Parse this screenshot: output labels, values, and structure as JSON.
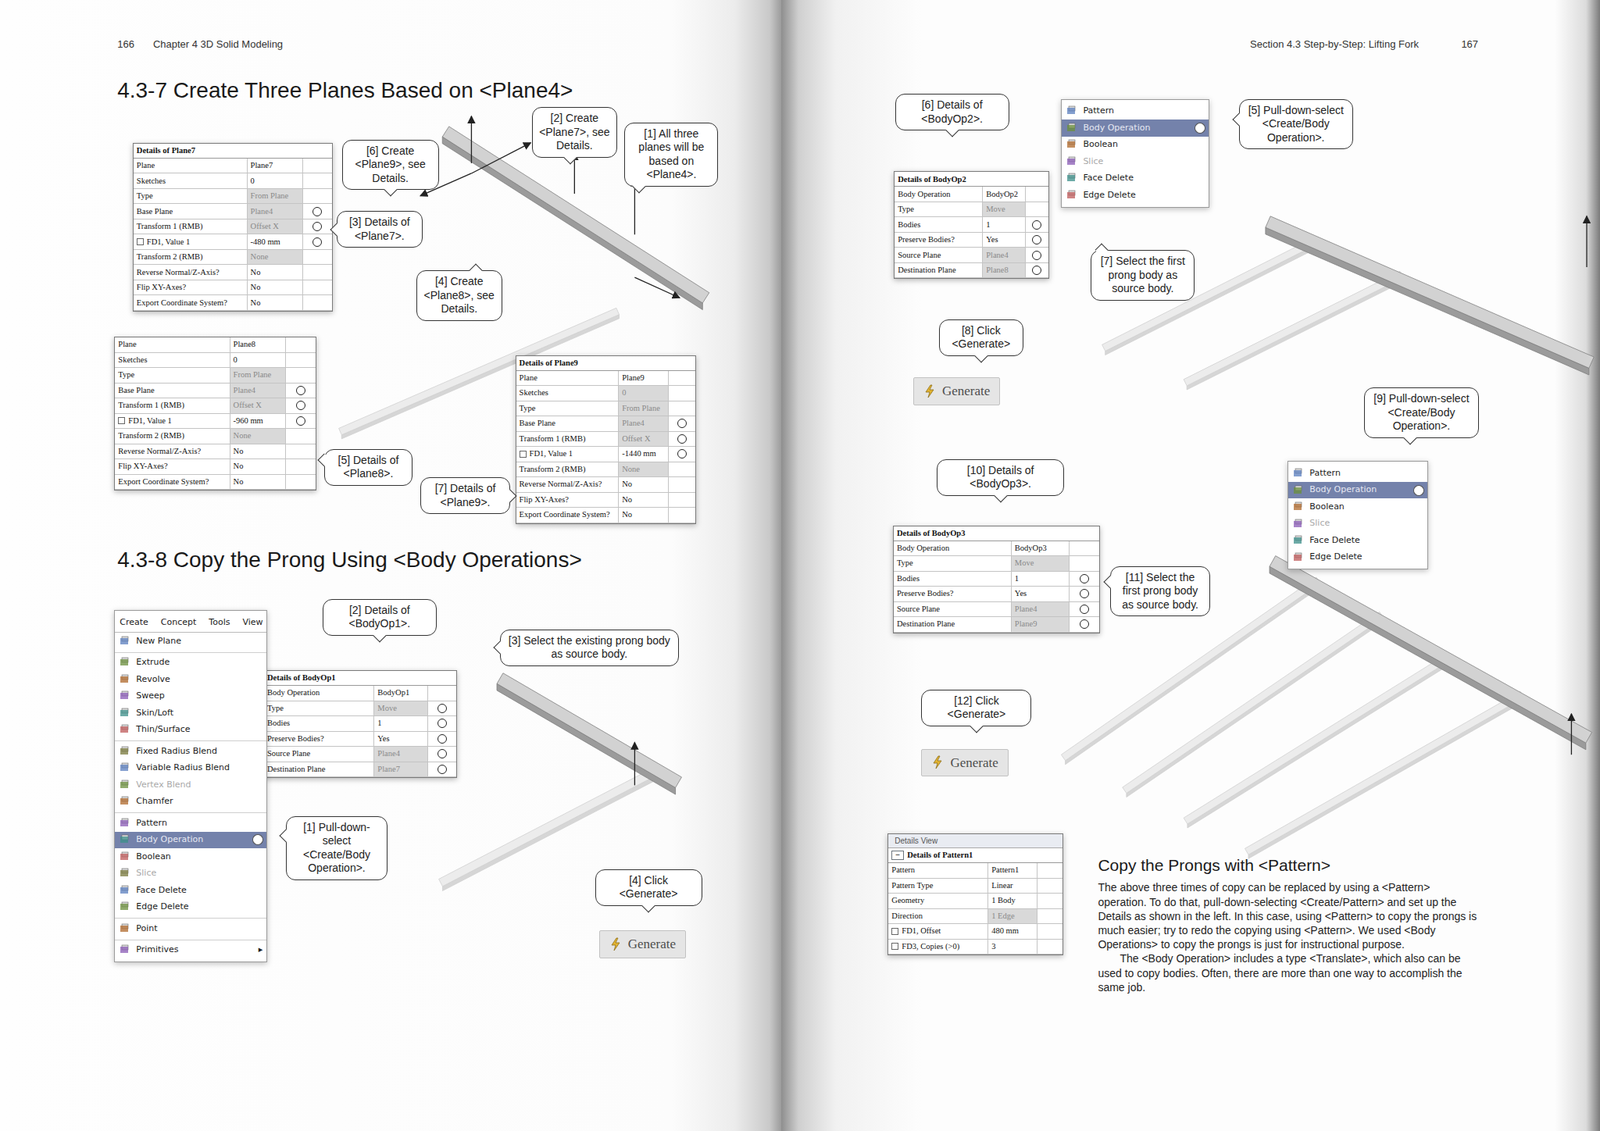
{
  "left_page": {
    "page_number": "166",
    "running_head": "Chapter 4  3D Solid Modeling",
    "heading_planes": "4.3-7  Create Three Planes Based on <Plane4>",
    "heading_copy": "4.3-8  Copy the Prong Using <Body Operations>"
  },
  "right_page": {
    "page_number": "167",
    "running_head": "Section 4.3  Step-by-Step: Lifting Fork"
  },
  "callouts": [
    {
      "text": "[1] All three planes will be based on <Plane4>."
    },
    {
      "text": "[2] Create <Plane7>, see Details."
    },
    {
      "text": "[3] Details of <Plane7>."
    },
    {
      "text": "[4] Create <Plane8>, see Details."
    },
    {
      "text": "[5] Details of <Plane8>."
    },
    {
      "text": "[6] Create <Plane9>, see Details."
    },
    {
      "text": "[7] Details of <Plane9>."
    },
    {
      "text": "[1] Pull-down-select <Create/Body Operation>."
    },
    {
      "text": "[2] Details of <BodyOp1>."
    },
    {
      "text": "[3] Select the existing prong body as source body."
    },
    {
      "text": "[4] Click <Generate>"
    },
    {
      "text": "[5] Pull-down-select <Create/Body Operation>."
    },
    {
      "text": "[6] Details of <BodyOp2>."
    },
    {
      "text": "[7] Select the first prong body as source body."
    },
    {
      "text": "[8] Click <Generate>"
    },
    {
      "text": "[9] Pull-down-select <Create/Body Operation>."
    },
    {
      "text": "[10] Details of <BodyOp3>."
    },
    {
      "text": "[11] Select the first prong body as source body."
    },
    {
      "text": "[12] Click <Generate>"
    }
  ],
  "tables": [
    {
      "title": "Details of Plane7",
      "rows": [
        {
          "label": "Plane",
          "value": "Plane7",
          "greyed": false,
          "marked": false,
          "kind": "plain"
        },
        {
          "label": "Sketches",
          "value": "0",
          "greyed": false,
          "marked": false,
          "kind": "plain"
        },
        {
          "label": "Type",
          "value": "From Plane",
          "greyed": true,
          "marked": false,
          "kind": "plain"
        },
        {
          "label": "Base Plane",
          "value": "Plane4",
          "greyed": true,
          "marked": true,
          "kind": "plain"
        },
        {
          "label": "Transform 1 (RMB)",
          "value": "Offset X",
          "greyed": true,
          "marked": true,
          "kind": "plain"
        },
        {
          "label": "FD1, Value 1",
          "value": "-480 mm",
          "greyed": false,
          "marked": true,
          "kind": "param"
        },
        {
          "label": "Transform 2 (RMB)",
          "value": "None",
          "greyed": true,
          "marked": false,
          "kind": "plain"
        },
        {
          "label": "Reverse Normal/Z-Axis?",
          "value": "No",
          "greyed": false,
          "marked": false,
          "kind": "plain"
        },
        {
          "label": "Flip XY-Axes?",
          "value": "No",
          "greyed": false,
          "marked": false,
          "kind": "plain"
        },
        {
          "label": "Export Coordinate System?",
          "value": "No",
          "greyed": false,
          "marked": false,
          "kind": "plain"
        }
      ]
    },
    {
      "rows": [
        {
          "label": "Plane",
          "value": "Plane8",
          "greyed": false,
          "marked": false,
          "kind": "plain"
        },
        {
          "label": "Sketches",
          "value": "0",
          "greyed": false,
          "marked": false,
          "kind": "plain"
        },
        {
          "label": "Type",
          "value": "From Plane",
          "greyed": true,
          "marked": false,
          "kind": "plain"
        },
        {
          "label": "Base Plane",
          "value": "Plane4",
          "greyed": true,
          "marked": true,
          "kind": "plain"
        },
        {
          "label": "Transform 1 (RMB)",
          "value": "Offset X",
          "greyed": true,
          "marked": true,
          "kind": "plain"
        },
        {
          "label": "FD1, Value 1",
          "value": "-960 mm",
          "greyed": false,
          "marked": true,
          "kind": "param"
        },
        {
          "label": "Transform 2 (RMB)",
          "value": "None",
          "greyed": true,
          "marked": false,
          "kind": "plain"
        },
        {
          "label": "Reverse Normal/Z-Axis?",
          "value": "No",
          "greyed": false,
          "marked": false,
          "kind": "plain"
        },
        {
          "label": "Flip XY-Axes?",
          "value": "No",
          "greyed": false,
          "marked": false,
          "kind": "plain"
        },
        {
          "label": "Export Coordinate System?",
          "value": "No",
          "greyed": false,
          "marked": false,
          "kind": "plain"
        }
      ]
    },
    {
      "title": "Details of Plane9",
      "rows": [
        {
          "label": "Plane",
          "value": "Plane9",
          "greyed": false,
          "marked": false,
          "kind": "plain"
        },
        {
          "label": "Sketches",
          "value": "0",
          "greyed": true,
          "marked": false,
          "kind": "plain"
        },
        {
          "label": "Type",
          "value": "From Plane",
          "greyed": true,
          "marked": false,
          "kind": "plain"
        },
        {
          "label": "Base Plane",
          "value": "Plane4",
          "greyed": true,
          "marked": true,
          "kind": "plain"
        },
        {
          "label": "Transform 1 (RMB)",
          "value": "Offset X",
          "greyed": true,
          "marked": true,
          "kind": "plain"
        },
        {
          "label": "FD1, Value 1",
          "value": "-1440 mm",
          "greyed": false,
          "marked": true,
          "kind": "param"
        },
        {
          "label": "Transform 2 (RMB)",
          "value": "None",
          "greyed": true,
          "marked": false,
          "kind": "plain"
        },
        {
          "label": "Reverse Normal/Z-Axis?",
          "value": "No",
          "greyed": false,
          "marked": false,
          "kind": "plain"
        },
        {
          "label": "Flip XY-Axes?",
          "value": "No",
          "greyed": false,
          "marked": false,
          "kind": "plain"
        },
        {
          "label": "Export Coordinate System?",
          "value": "No",
          "greyed": false,
          "marked": false,
          "kind": "plain"
        }
      ]
    },
    {
      "title": "Details of BodyOp1",
      "rows": [
        {
          "label": "Body Operation",
          "value": "BodyOp1",
          "greyed": false,
          "marked": false,
          "kind": "plain"
        },
        {
          "label": "Type",
          "value": "Move",
          "greyed": true,
          "marked": true,
          "kind": "plain"
        },
        {
          "label": "Bodies",
          "value": "1",
          "greyed": false,
          "marked": true,
          "kind": "plain"
        },
        {
          "label": "Preserve Bodies?",
          "value": "Yes",
          "greyed": false,
          "marked": true,
          "kind": "plain"
        },
        {
          "label": "Source Plane",
          "value": "Plane4",
          "greyed": true,
          "marked": true,
          "kind": "plain"
        },
        {
          "label": "Destination Plane",
          "value": "Plane7",
          "greyed": true,
          "marked": true,
          "kind": "plain"
        }
      ]
    },
    {
      "title": "Details of BodyOp2",
      "rows": [
        {
          "label": "Body Operation",
          "value": "BodyOp2",
          "greyed": false,
          "marked": false,
          "kind": "plain"
        },
        {
          "label": "Type",
          "value": "Move",
          "greyed": true,
          "marked": false,
          "kind": "plain"
        },
        {
          "label": "Bodies",
          "value": "1",
          "greyed": false,
          "marked": true,
          "kind": "plain"
        },
        {
          "label": "Preserve Bodies?",
          "value": "Yes",
          "greyed": false,
          "marked": true,
          "kind": "plain"
        },
        {
          "label": "Source Plane",
          "value": "Plane4",
          "greyed": true,
          "marked": true,
          "kind": "plain"
        },
        {
          "label": "Destination Plane",
          "value": "Plane8",
          "greyed": true,
          "marked": true,
          "kind": "plain"
        }
      ]
    },
    {
      "title": "Details of BodyOp3",
      "rows": [
        {
          "label": "Body Operation",
          "value": "BodyOp3",
          "greyed": false,
          "marked": false,
          "kind": "plain"
        },
        {
          "label": "Type",
          "value": "Move",
          "greyed": true,
          "marked": false,
          "kind": "plain"
        },
        {
          "label": "Bodies",
          "value": "1",
          "greyed": false,
          "marked": true,
          "kind": "plain"
        },
        {
          "label": "Preserve Bodies?",
          "value": "Yes",
          "greyed": false,
          "marked": true,
          "kind": "plain"
        },
        {
          "label": "Source Plane",
          "value": "Plane4",
          "greyed": true,
          "marked": true,
          "kind": "plain"
        },
        {
          "label": "Destination Plane",
          "value": "Plane9",
          "greyed": true,
          "marked": true,
          "kind": "plain"
        }
      ]
    },
    {
      "header": "Details View",
      "collapse_glyph": "−",
      "title": "Details of Pattern1",
      "rows": [
        {
          "label": "Pattern",
          "value": "Pattern1",
          "greyed": false,
          "marked": false,
          "kind": "plain"
        },
        {
          "label": "Pattern Type",
          "value": "Linear",
          "greyed": false,
          "marked": false,
          "kind": "plain"
        },
        {
          "label": "Geometry",
          "value": "1 Body",
          "greyed": false,
          "marked": false,
          "kind": "plain"
        },
        {
          "label": "Direction",
          "value": "1 Edge",
          "greyed": true,
          "marked": false,
          "kind": "plain"
        },
        {
          "label": "FD1, Offset",
          "value": "480 mm",
          "greyed": false,
          "marked": false,
          "kind": "param"
        },
        {
          "label": "FD3, Copies (>0)",
          "value": "3",
          "greyed": false,
          "marked": false,
          "kind": "param"
        }
      ]
    }
  ],
  "menus": [
    {
      "menubar": [
        "Create",
        "Concept",
        "Tools",
        "View"
      ],
      "items": [
        {
          "label": "New Plane",
          "selected": false,
          "disabled": false,
          "separator_before": false
        },
        {
          "label": "Extrude",
          "selected": false,
          "disabled": false,
          "separator_before": true
        },
        {
          "label": "Revolve",
          "selected": false,
          "disabled": false,
          "separator_before": false
        },
        {
          "label": "Sweep",
          "selected": false,
          "disabled": false,
          "separator_before": false
        },
        {
          "label": "Skin/Loft",
          "selected": false,
          "disabled": false,
          "separator_before": false
        },
        {
          "label": "Thin/Surface",
          "selected": false,
          "disabled": false,
          "separator_before": false
        },
        {
          "label": "Fixed Radius Blend",
          "selected": false,
          "disabled": false,
          "separator_before": true
        },
        {
          "label": "Variable Radius Blend",
          "selected": false,
          "disabled": false,
          "separator_before": false
        },
        {
          "label": "Vertex Blend",
          "selected": false,
          "disabled": true,
          "separator_before": false
        },
        {
          "label": "Chamfer",
          "selected": false,
          "disabled": false,
          "separator_before": false
        },
        {
          "label": "Pattern",
          "selected": false,
          "disabled": false,
          "separator_before": true
        },
        {
          "label": "Body Operation",
          "selected": true,
          "disabled": false,
          "separator_before": false
        },
        {
          "label": "Boolean",
          "selected": false,
          "disabled": false,
          "separator_before": false
        },
        {
          "label": "Slice",
          "selected": false,
          "disabled": true,
          "separator_before": false
        },
        {
          "label": "Face Delete",
          "selected": false,
          "disabled": false,
          "separator_before": false
        },
        {
          "label": "Edge Delete",
          "selected": false,
          "disabled": false,
          "separator_before": false
        },
        {
          "label": "Point",
          "selected": false,
          "disabled": false,
          "separator_before": true
        },
        {
          "label": "Primitives",
          "selected": false,
          "disabled": false,
          "separator_before": true,
          "arrow": "▸"
        }
      ]
    },
    {
      "items": [
        {
          "label": "Pattern",
          "selected": false,
          "disabled": false,
          "separator_before": false
        },
        {
          "label": "Body Operation",
          "selected": true,
          "disabled": false,
          "separator_before": false
        },
        {
          "label": "Boolean",
          "selected": false,
          "disabled": false,
          "separator_before": false
        },
        {
          "label": "Slice",
          "selected": false,
          "disabled": true,
          "separator_before": false
        },
        {
          "label": "Face Delete",
          "selected": false,
          "disabled": false,
          "separator_before": false
        },
        {
          "label": "Edge Delete",
          "selected": false,
          "disabled": false,
          "separator_before": false
        }
      ]
    },
    {
      "items": [
        {
          "label": "Pattern",
          "selected": false,
          "disabled": false,
          "separator_before": false
        },
        {
          "label": "Body Operation",
          "selected": true,
          "disabled": false,
          "separator_before": false
        },
        {
          "label": "Boolean",
          "selected": false,
          "disabled": false,
          "separator_before": false
        },
        {
          "label": "Slice",
          "selected": false,
          "disabled": true,
          "separator_before": false
        },
        {
          "label": "Face Delete",
          "selected": false,
          "disabled": false,
          "separator_before": false
        },
        {
          "label": "Edge Delete",
          "selected": false,
          "disabled": false,
          "separator_before": false
        }
      ]
    }
  ],
  "generate_buttons": [
    {
      "label": "Generate"
    },
    {
      "label": "Generate"
    },
    {
      "label": "Generate"
    }
  ],
  "pattern_note": {
    "title": "Copy the Prongs with <Pattern>",
    "paragraphs": [
      "The above three times of copy can be replaced by using a <Pattern> operation. To do that, pull-down-selecting <Create/Pattern> and set up the Details as shown in the left. In this case, using <Pattern> to copy the prongs is much easier; try to redo the copying using <Pattern>. We used <Body Operations> to copy the prongs is just for instructional purpose.",
      "The <Body Operation> includes a type <Translate>, which also can be used to copy bodies. Often, there are more than one way to accomplish the same job."
    ]
  }
}
